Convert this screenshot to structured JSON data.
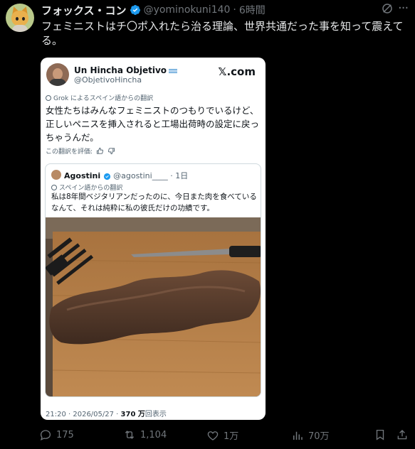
{
  "post": {
    "display_name": "フォックス・コン",
    "handle": "@yominokuni140",
    "separator": "·",
    "time": "6時間",
    "text": "フェミニストはチ〇ポ入れたら治る理論、世界共通だった事を知って震えてる。"
  },
  "quoted_card": {
    "name": "Un Hincha Objetivo",
    "handle": "@ObjetivoHincha",
    "logo_text": ".com",
    "translation_note": "Grok によるスペイン語からの翻訳",
    "text": "女性たちはみんなフェミニストのつもりでいるけど、正しいペニスを挿入されると工場出荷時の設定に戻っちゃうんだ。",
    "rate_label": "この翻訳を評価:",
    "inner_quote": {
      "name": "Agostini",
      "handle": "@agostini____",
      "separator": "·",
      "time": "1日",
      "translation_note": "スペイン語からの翻訳",
      "text": "私は8年間ベジタリアンだったのに、今日また肉を食べているなんて、それは純粋に私の彼氏だけの功績です。"
    },
    "footer": {
      "datetime": "21:20 · 2026/05/27 · ",
      "views": "370 万",
      "views_label": "回表示"
    }
  },
  "actions": {
    "replies": "175",
    "reposts": "1,104",
    "likes": "1万",
    "views": "70万"
  },
  "colors": {
    "background": "#000000",
    "text": "#e7e9ea",
    "muted": "#71767b",
    "verified": "#1d9bf0"
  },
  "icons": [
    "verified-badge-icon",
    "grok-icon",
    "more-icon",
    "reply-icon",
    "repost-icon",
    "like-icon",
    "views-icon",
    "bookmark-icon",
    "share-icon"
  ]
}
